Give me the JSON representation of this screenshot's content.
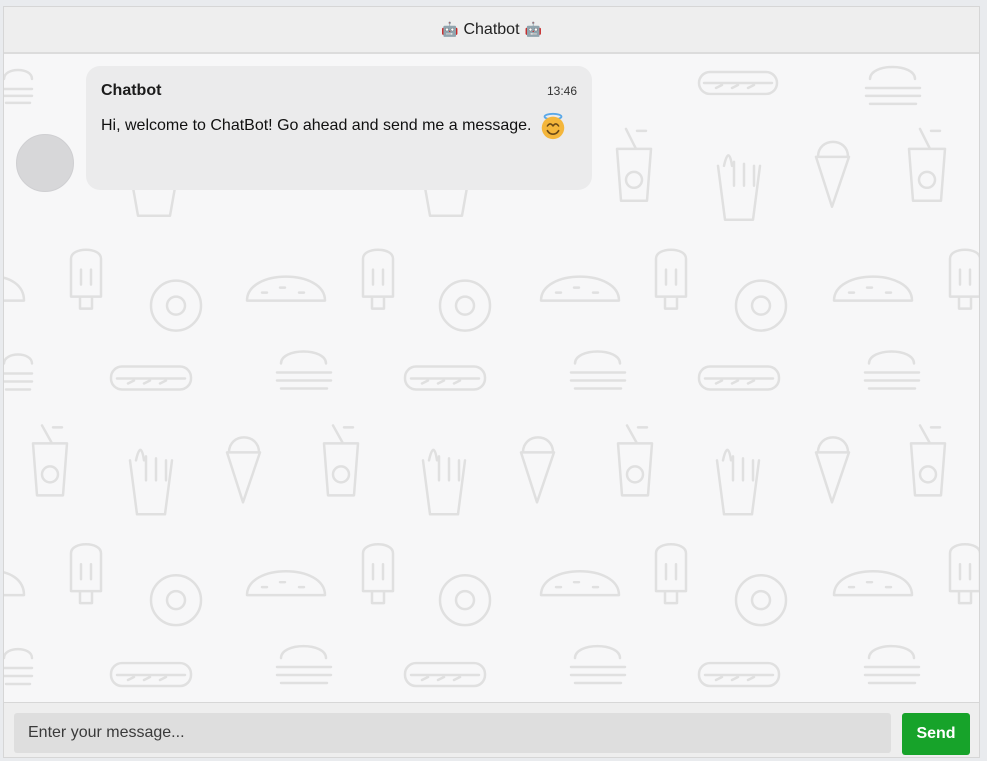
{
  "header": {
    "title": "Chatbot",
    "left_icon": "robot-icon",
    "right_icon": "robot-icon",
    "left_glyph": "🤖",
    "right_glyph": "🤖"
  },
  "messages": [
    {
      "sender": "Chatbot",
      "time": "13:46",
      "text": "Hi, welcome to ChatBot! Go ahead and send me a message.",
      "emoji": "smiling-face-with-halo-icon"
    }
  ],
  "input": {
    "placeholder": "Enter your message...",
    "value": ""
  },
  "send_button": {
    "label": "Send"
  },
  "colors": {
    "send_button": "#17a32a",
    "bubble_bg": "#ebebec",
    "chat_bg": "#f7f7f8"
  }
}
